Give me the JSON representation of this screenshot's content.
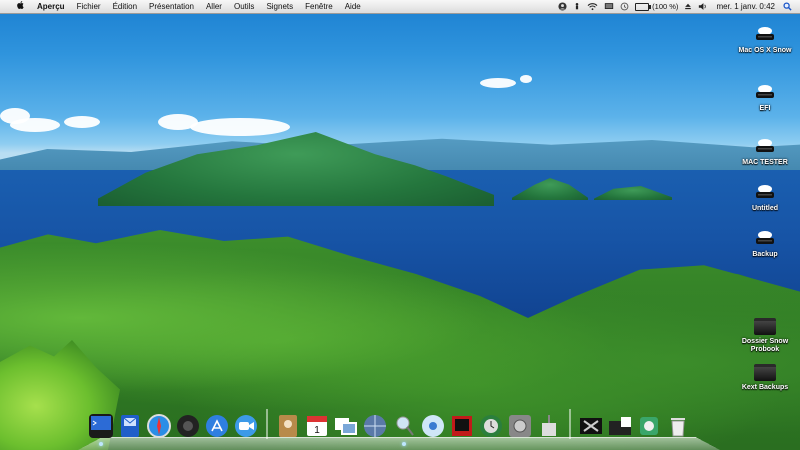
{
  "menubar": {
    "app_name": "Aperçu",
    "menus": [
      "Fichier",
      "Édition",
      "Présentation",
      "Aller",
      "Outils",
      "Signets",
      "Fenêtre",
      "Aide"
    ],
    "battery_text": "(100 %)",
    "clock": "mer. 1 janv.  0:42",
    "status_icons": [
      "user-icon",
      "person-icon",
      "wifi-icon",
      "display-icon",
      "time-machine-icon",
      "battery-icon",
      "eject-icon",
      "volume-icon",
      "spotlight-icon"
    ]
  },
  "desktop_icons": [
    {
      "label": "Mac OS X Snow",
      "icon": "drive-icon"
    },
    {
      "label": "EFI",
      "icon": "drive-icon"
    },
    {
      "label": "MAC TESTER",
      "icon": "drive-icon"
    },
    {
      "label": "Untitled",
      "icon": "drive-icon"
    },
    {
      "label": "Backup",
      "icon": "drive-icon"
    },
    {
      "label": "Dossier Snow Probook",
      "icon": "folder-icon"
    },
    {
      "label": "Kext Backups",
      "icon": "folder-icon"
    }
  ],
  "dock": {
    "items": [
      {
        "icon": "finder-icon"
      },
      {
        "icon": "mail-icon"
      },
      {
        "icon": "safari-icon"
      },
      {
        "icon": "frontrow-icon"
      },
      {
        "icon": "appstore-icon"
      },
      {
        "icon": "facetime-icon"
      },
      {
        "icon": "contacts-icon"
      },
      {
        "icon": "calendar-icon",
        "text": "1"
      },
      {
        "icon": "photos-icon"
      },
      {
        "icon": "network-icon"
      },
      {
        "icon": "preview-icon"
      },
      {
        "icon": "itunes-icon"
      },
      {
        "icon": "photobooth-icon"
      },
      {
        "icon": "timemachine-icon"
      },
      {
        "icon": "systemprefs-icon"
      },
      {
        "icon": "utility-icon"
      },
      {
        "icon": "x11-icon"
      },
      {
        "icon": "folder-stack-icon"
      },
      {
        "icon": "applications-stack-icon"
      },
      {
        "icon": "trash-icon"
      }
    ]
  }
}
